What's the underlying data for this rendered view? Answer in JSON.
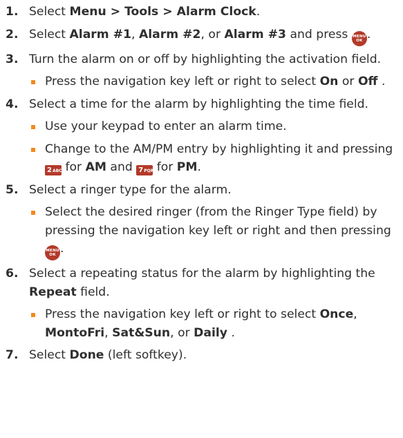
{
  "steps": [
    {
      "num": "1.",
      "t1": "Select ",
      "b1": "Menu > Tools > Alarm Clock",
      "t2": "."
    },
    {
      "num": "2.",
      "t1": "Select ",
      "b1": "Alarm #1",
      "t2": ", ",
      "b2": "Alarm #2",
      "t3": ", or ",
      "b3": "Alarm #3",
      "t4": " and press ",
      "key": {
        "line1": "MENU",
        "line2": "OK"
      },
      "t5": "."
    },
    {
      "num": "3.",
      "text": "Turn the alarm on or off by highlighting the activation field.",
      "bullets": [
        {
          "t1": "Press the navigation key left or right to select ",
          "b1": "On",
          "t2": " or ",
          "b2": "Off",
          "t3": " ."
        }
      ]
    },
    {
      "num": "4.",
      "text": "Select a time for the alarm by highlighting the time field.",
      "bullets": [
        {
          "text": "Use your keypad to enter an alarm time."
        },
        {
          "t1": "Change to the AM/PM entry by highlighting it and pressing ",
          "k1": {
            "digit": "2",
            "letters": "ABC"
          },
          "t2": " for ",
          "b1": "AM",
          "t3": " and ",
          "k2": {
            "digit": "7",
            "letters": "PQRS"
          },
          "t4": " for ",
          "b2": "PM",
          "t5": "."
        }
      ]
    },
    {
      "num": "5.",
      "text": "Select a ringer type for the alarm.",
      "bullets": [
        {
          "t1": "Select the desired ringer (from the Ringer Type field) by pressing the navigation key left or right and then pressing ",
          "key": {
            "line1": "MENU",
            "line2": "OK"
          },
          "t2": "."
        }
      ]
    },
    {
      "num": "6.",
      "t1": "Select a repeating status for the alarm by highlighting the ",
      "b1": "Repeat",
      "t2": " field.",
      "bullets": [
        {
          "t1": "Press the navigation key left or right to select ",
          "b1": "Once",
          "t2": ", ",
          "b2": "MontoFri",
          "t3": ", ",
          "b3": "Sat&Sun",
          "t4": ", or ",
          "b4": "Daily",
          "t5": " ."
        }
      ]
    },
    {
      "num": "7.",
      "t1": "Select ",
      "b1": "Done",
      "t2": " (left softkey)."
    }
  ],
  "colors": {
    "bullet": "#f28a1c",
    "key": "#b33a2a",
    "text": "#2f2f2f"
  }
}
